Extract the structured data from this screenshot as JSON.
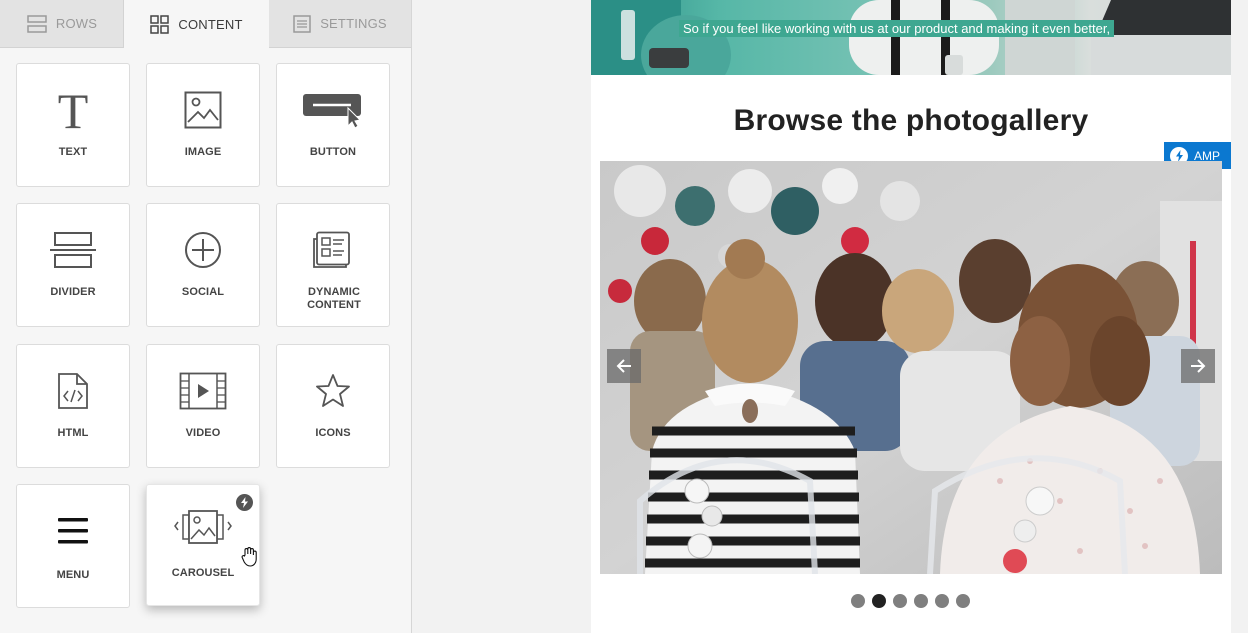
{
  "tabs": [
    {
      "label": "ROWS",
      "icon": "rows-icon",
      "active": false
    },
    {
      "label": "CONTENT",
      "icon": "grid-icon",
      "active": true
    },
    {
      "label": "SETTINGS",
      "icon": "settings-list-icon",
      "active": false
    }
  ],
  "blocks": {
    "text": "TEXT",
    "image": "IMAGE",
    "button": "BUTTON",
    "divider": "DIVIDER",
    "social": "SOCIAL",
    "dynamic": "DYNAMIC CONTENT",
    "html": "HTML",
    "video": "VIDEO",
    "icons": "ICONS",
    "menu": "MENU",
    "carousel": "CAROUSEL"
  },
  "canvas": {
    "hero_caption": "So if you feel like working with us at our product and making it even better,",
    "gallery_title": "Browse the photogallery",
    "amp_badge": "AMP",
    "carousel_dot_count": 6,
    "carousel_active_dot": 2
  },
  "colors": {
    "amp_blue": "#0b78d0",
    "hero_teal": "#3ea791",
    "icon_gray": "#555555"
  }
}
